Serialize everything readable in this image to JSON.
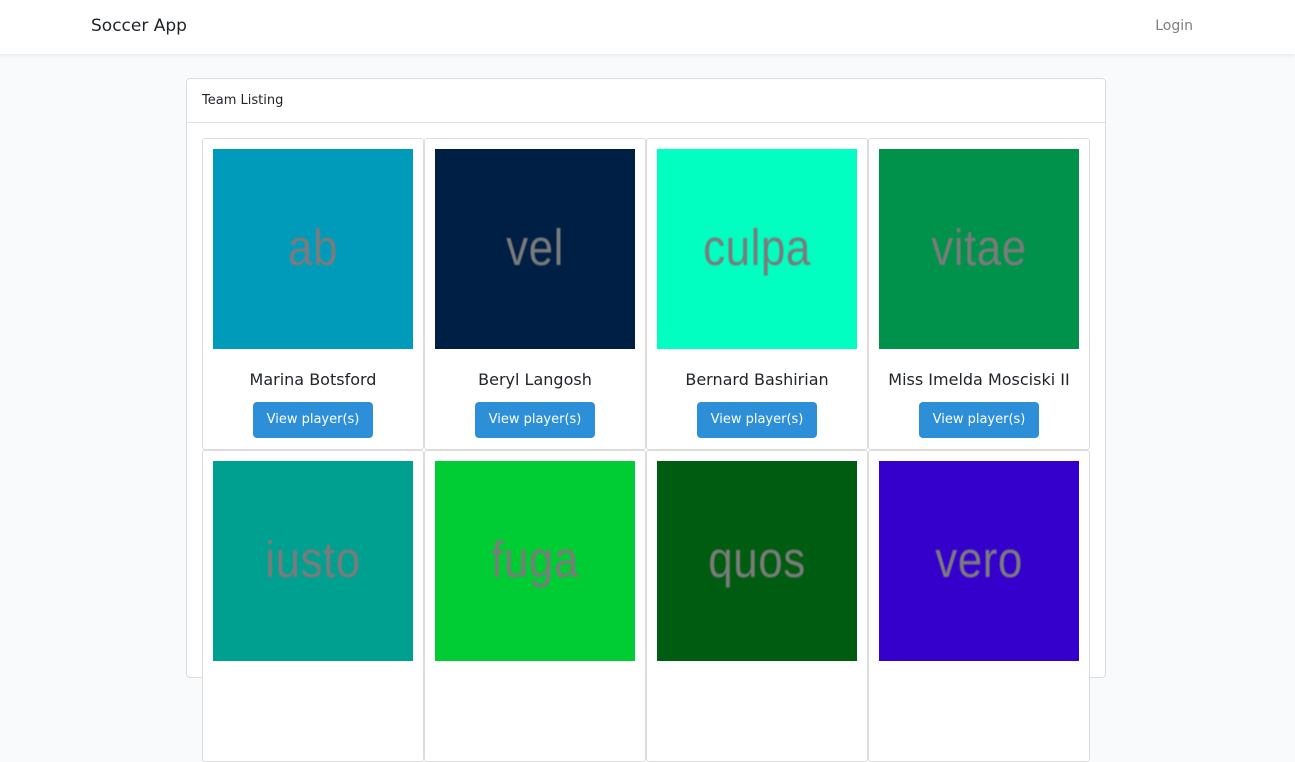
{
  "navbar": {
    "brand": "Soccer App",
    "login": "Login"
  },
  "card": {
    "header": "Team Listing"
  },
  "teams": [
    {
      "name": "Marina Botsford",
      "image_text": "ab",
      "color": "#009bbb",
      "button": "View player(s)"
    },
    {
      "name": "Beryl Langosh",
      "image_text": "vel",
      "color": "#001f44",
      "button": "View player(s)"
    },
    {
      "name": "Bernard Bashirian",
      "image_text": "culpa",
      "color": "#00ffc0",
      "button": "View player(s)"
    },
    {
      "name": "Miss Imelda Mosciski II",
      "image_text": "vitae",
      "color": "#00914b",
      "button": "View player(s)"
    },
    {
      "name": "",
      "image_text": "iusto",
      "color": "#00a090",
      "button": ""
    },
    {
      "name": "",
      "image_text": "fuga",
      "color": "#00cc33",
      "button": ""
    },
    {
      "name": "",
      "image_text": "quos",
      "color": "#005c11",
      "button": ""
    },
    {
      "name": "",
      "image_text": "vero",
      "color": "#3600cc",
      "button": ""
    }
  ]
}
